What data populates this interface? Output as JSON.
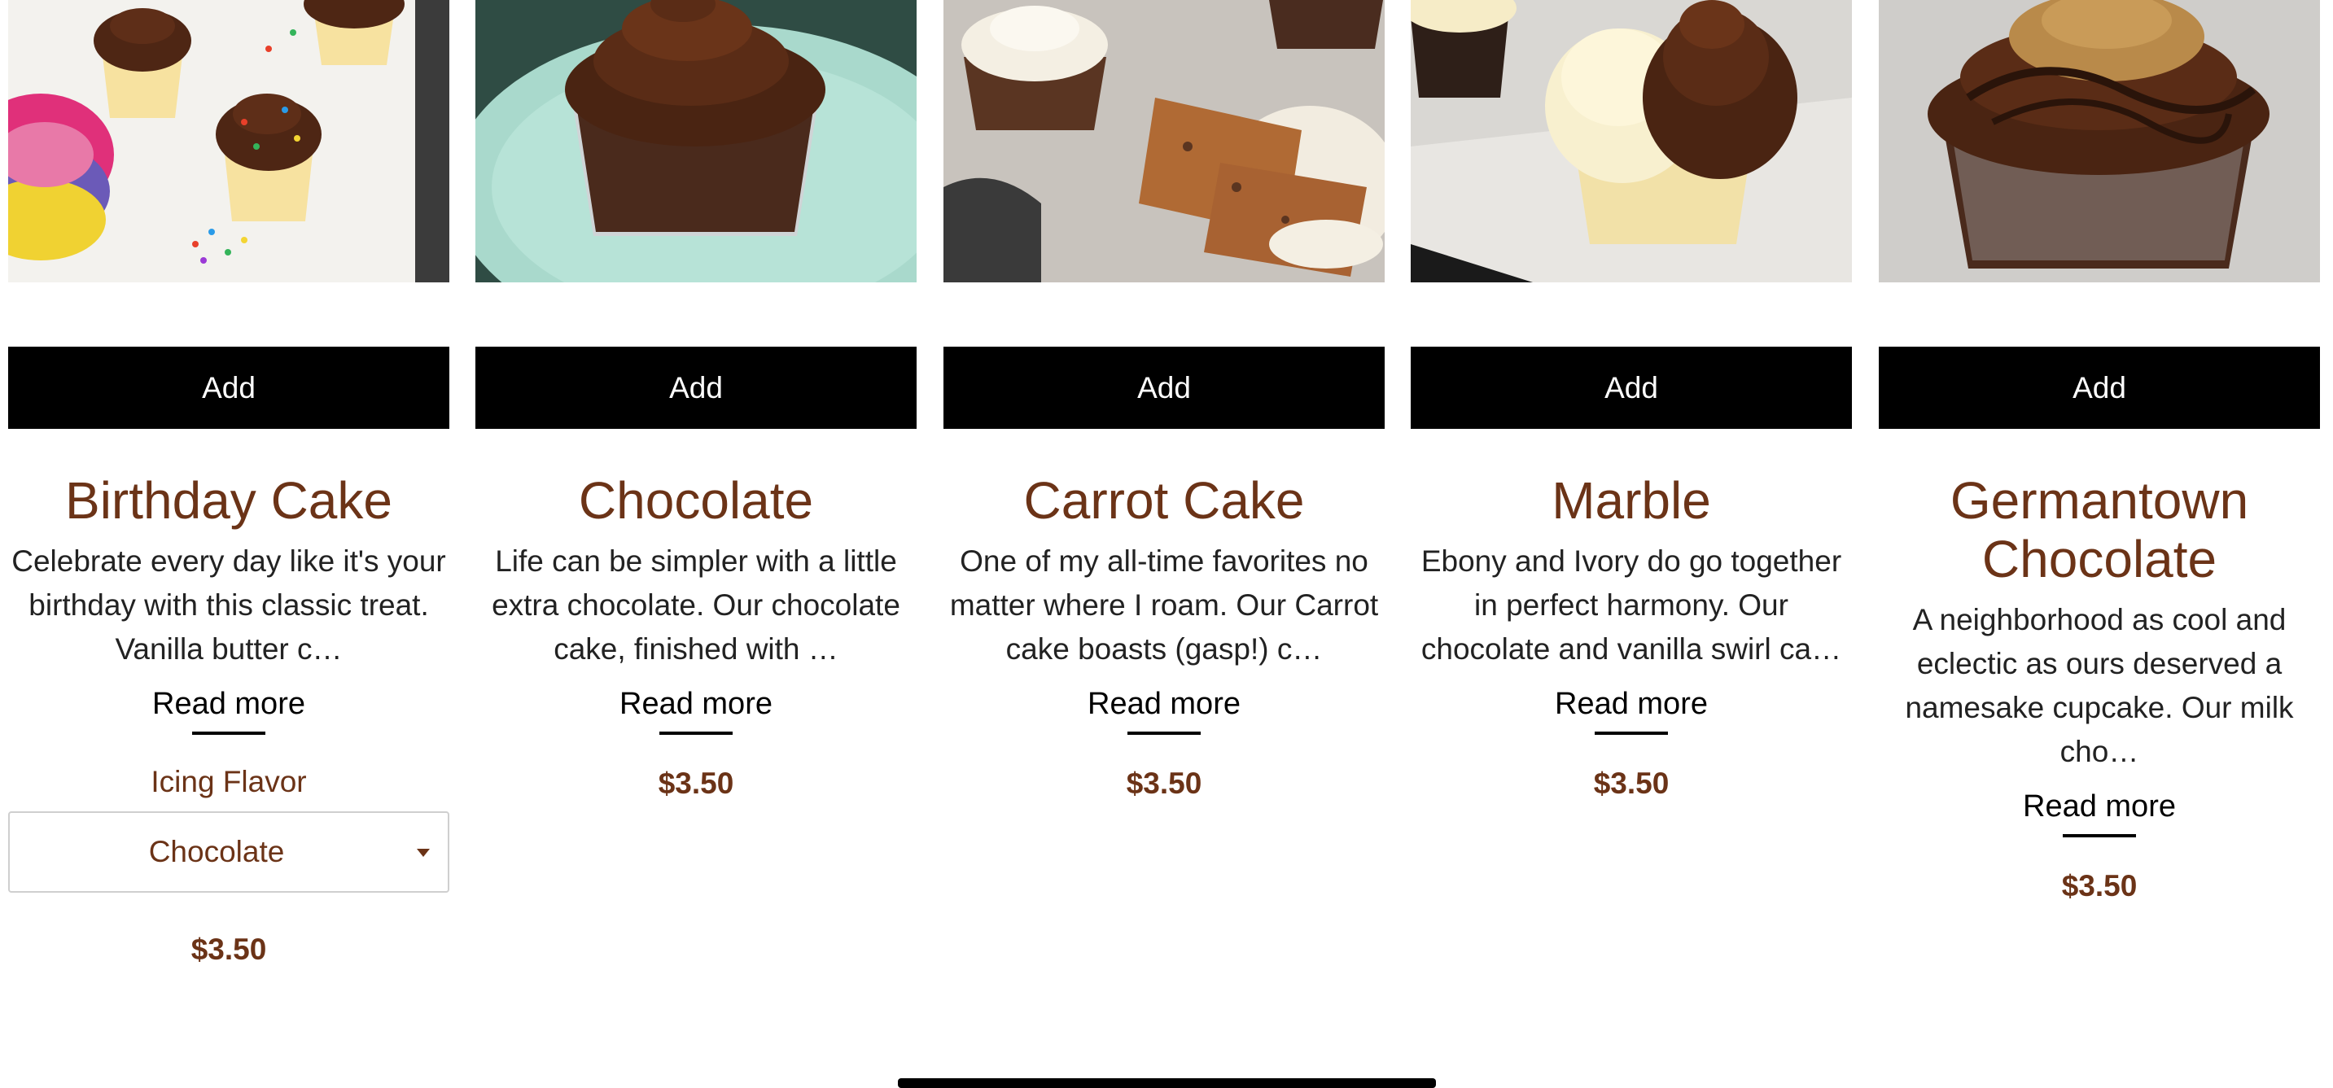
{
  "products": [
    {
      "title": "Birthday Cake",
      "description": "Celebrate every day like it's your birthday with this classic treat. Vanilla butter c…",
      "add_label": "Add",
      "read_more": "Read more",
      "icing_label": "Icing Flavor",
      "icing_value": "Chocolate",
      "price": "$3.50"
    },
    {
      "title": "Chocolate",
      "description": "Life can be simpler with a little extra chocolate. Our chocolate cake, finished with …",
      "add_label": "Add",
      "read_more": "Read more",
      "price": "$3.50"
    },
    {
      "title": "Carrot Cake",
      "description": "One of my all-time favorites no matter where I roam. Our Carrot cake boasts (gasp!) c…",
      "add_label": "Add",
      "read_more": "Read more",
      "price": "$3.50"
    },
    {
      "title": "Marble",
      "description": "Ebony and Ivory do go together in perfect harmony. Our chocolate and vanilla swirl ca…",
      "add_label": "Add",
      "read_more": "Read more",
      "price": "$3.50"
    },
    {
      "title": "Germantown Chocolate",
      "description": "A neighborhood as cool and eclectic as ours deserved a namesake cupcake. Our milk cho…",
      "add_label": "Add",
      "read_more": "Read more",
      "price": "$3.50"
    }
  ],
  "colors": {
    "accent_brown": "#6b3317",
    "button_bg": "#000000",
    "button_text": "#ffffff"
  }
}
